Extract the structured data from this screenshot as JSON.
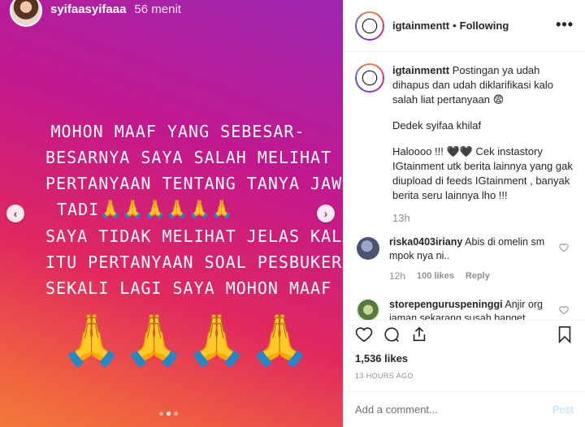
{
  "story": {
    "username": "syifaasyifaaa",
    "time": "56 menit",
    "lines": [
      "MOHON MAAF YANG SEBESAR-",
      "BESARNYA SAYA SALAH MELIHAT",
      "PERTANYAAN TENTANG TANYA JAWAB",
      "TADI",
      "SAYA TIDAK MELIHAT JELAS KALAU",
      "ITU PERTANYAAN SOAL PESBUKERS",
      "SEKALI LAGI SAYA MOHON MAAF"
    ],
    "pray_inline_tadi": "🙏🙏🙏🙏🙏🙏",
    "pray_inline_end": "🙏",
    "pray_big": [
      "🙏",
      "🙏",
      "🙏",
      "🙏"
    ],
    "carousel_dots": 3,
    "active_dot": 1
  },
  "post": {
    "username": "igtainmentt",
    "follow_status": "Following",
    "caption_paragraphs": [
      "Postingan ya udah dihapus dan udah diklarifikasi kalo salah liat pertanyaan 😨",
      "Dedek syifaa khilaf",
      "Haloooo !!! 🖤🖤 Cek instastory IGtainment utk berita lainnya yang gak diupload di feeds IGtainment , banyak berita seru lainnya lho !!!"
    ],
    "caption_time": "13h",
    "comments": [
      {
        "username": "riska0403iriany",
        "text": "Abis di omelin sm mpok nya ni..",
        "time": "12h",
        "likes": "100 likes",
        "reply": "Reply"
      },
      {
        "username": "storepenguruspeninggi",
        "text": "Anjir org jaman sekarang susah banget"
      }
    ],
    "likes": "1,536 likes",
    "timestamp": "13 HOURS AGO",
    "add_comment_placeholder": "Add a comment...",
    "post_label": "Post",
    "post_button_color": "#b2dffc"
  }
}
